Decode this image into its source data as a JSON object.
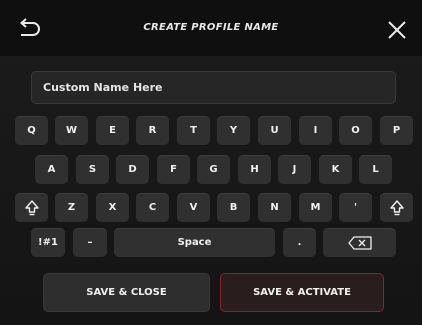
{
  "header": {
    "title": "CREATE PROFILE NAME",
    "back_icon": "back-arrow-icon",
    "close_icon": "close-icon"
  },
  "name_field": {
    "value": "Custom Name Here"
  },
  "keyboard": {
    "row1": [
      "Q",
      "W",
      "E",
      "R",
      "T",
      "Y",
      "U",
      "I",
      "O",
      "P"
    ],
    "row2": [
      "A",
      "S",
      "D",
      "F",
      "G",
      "H",
      "J",
      "K",
      "L"
    ],
    "row3": [
      "Z",
      "X",
      "C",
      "V",
      "B",
      "N",
      "M",
      "'"
    ],
    "row4": {
      "symbols": "!#1",
      "dash": "–",
      "space": "Space",
      "period": "."
    },
    "shift_icon": "shift-icon",
    "backspace_icon": "backspace-icon"
  },
  "actions": {
    "save_close": "SAVE & CLOSE",
    "save_activate": "SAVE & ACTIVATE"
  },
  "colors": {
    "background": "#181818",
    "key": "#303030",
    "activate_border": "#8a2424"
  }
}
